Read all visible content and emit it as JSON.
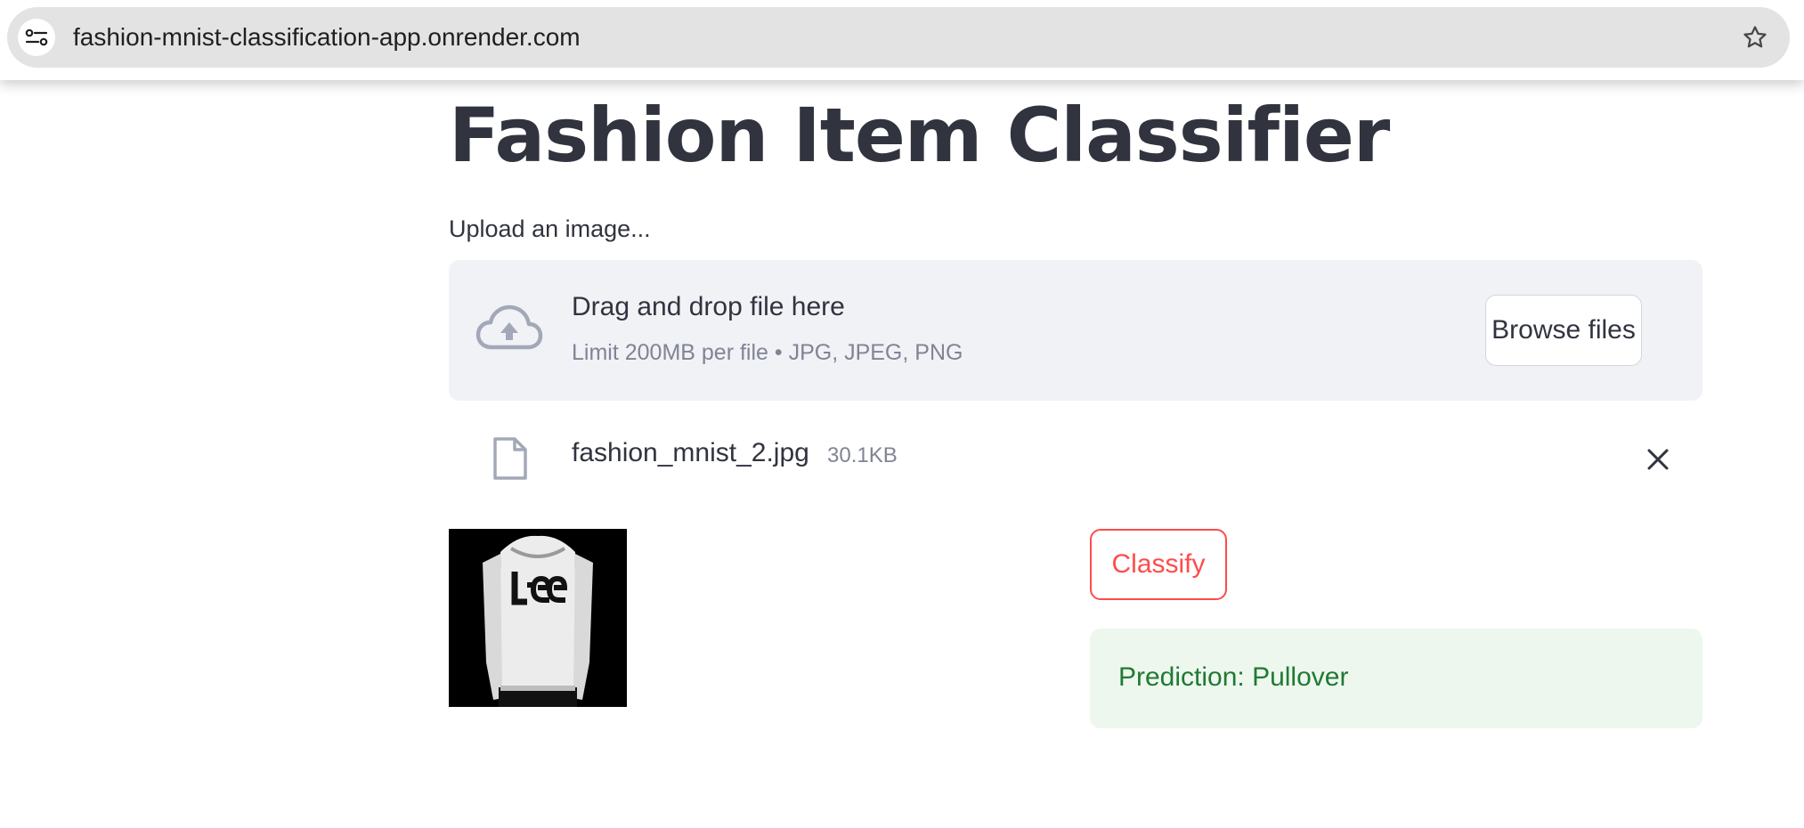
{
  "browser": {
    "url": "fashion-mnist-classification-app.onrender.com",
    "site_info_icon": "tune-icon",
    "bookmark_icon": "star-icon"
  },
  "app": {
    "title": "Fashion Item Classifier",
    "upload_label": "Upload an image...",
    "dropzone": {
      "icon": "cloud-upload-icon",
      "title": "Drag and drop file here",
      "subtitle": "Limit 200MB per file • JPG, JPEG, PNG",
      "browse_label": "Browse files"
    },
    "uploaded_file": {
      "icon": "file-icon",
      "name": "fashion_mnist_2.jpg",
      "size": "30.1KB",
      "remove_icon": "close-icon"
    },
    "preview_image": "pullover-thumbnail",
    "classify_label": "Classify",
    "prediction": "Prediction: Pullover"
  },
  "colors": {
    "accent": "#ff4b4b",
    "success_bg": "#eef7ee",
    "success_text": "#1f7a33",
    "dropzone_bg": "#f0f2f6"
  }
}
